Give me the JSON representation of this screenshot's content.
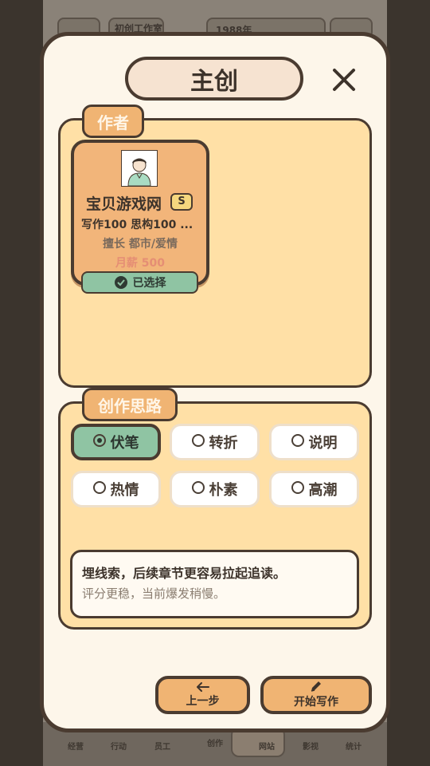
{
  "background": {
    "studio_name": "初创工作室",
    "year": "1988年",
    "nav": [
      "经营",
      "行动",
      "员工",
      "创作",
      "网站",
      "影视",
      "统计"
    ]
  },
  "modal": {
    "title": "主创",
    "close_icon": "close-icon"
  },
  "author_section": {
    "label": "作者",
    "card": {
      "name": "宝贝游戏网",
      "rank": "S",
      "stats": "写作100 思构100 ...",
      "specialty": "擅长 都市/爱情",
      "salary": "月薪 500",
      "selected_label": "已选择"
    }
  },
  "idea_section": {
    "label": "创作思路",
    "options": [
      {
        "label": "伏笔",
        "selected": true
      },
      {
        "label": "转折",
        "selected": false
      },
      {
        "label": "说明",
        "selected": false
      },
      {
        "label": "热情",
        "selected": false
      },
      {
        "label": "朴素",
        "selected": false
      },
      {
        "label": "高潮",
        "selected": false
      }
    ],
    "description": {
      "main": "埋线索，后续章节更容易拉起追读。",
      "sub": "评分更稳，当前爆发稍慢。"
    }
  },
  "actions": {
    "back_label": "上一步",
    "start_label": "开始写作"
  },
  "colors": {
    "accent": "#f0b473",
    "selected": "#8fc4a3",
    "panel": "#ffe0a6",
    "border": "#4a3b30"
  }
}
